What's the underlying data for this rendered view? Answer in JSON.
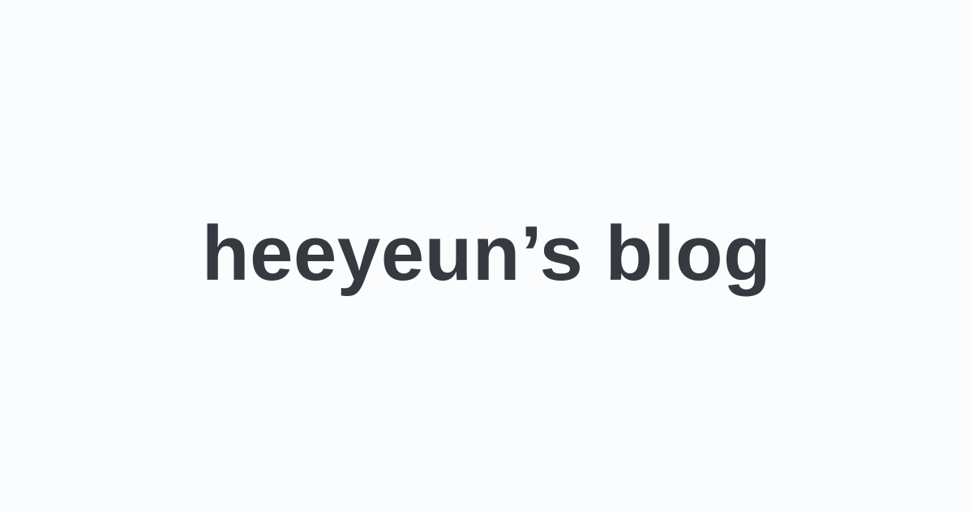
{
  "site": {
    "title": "heeyeun’s blog"
  },
  "colors": {
    "background": "#fbfcfd",
    "text": "#343a40"
  }
}
